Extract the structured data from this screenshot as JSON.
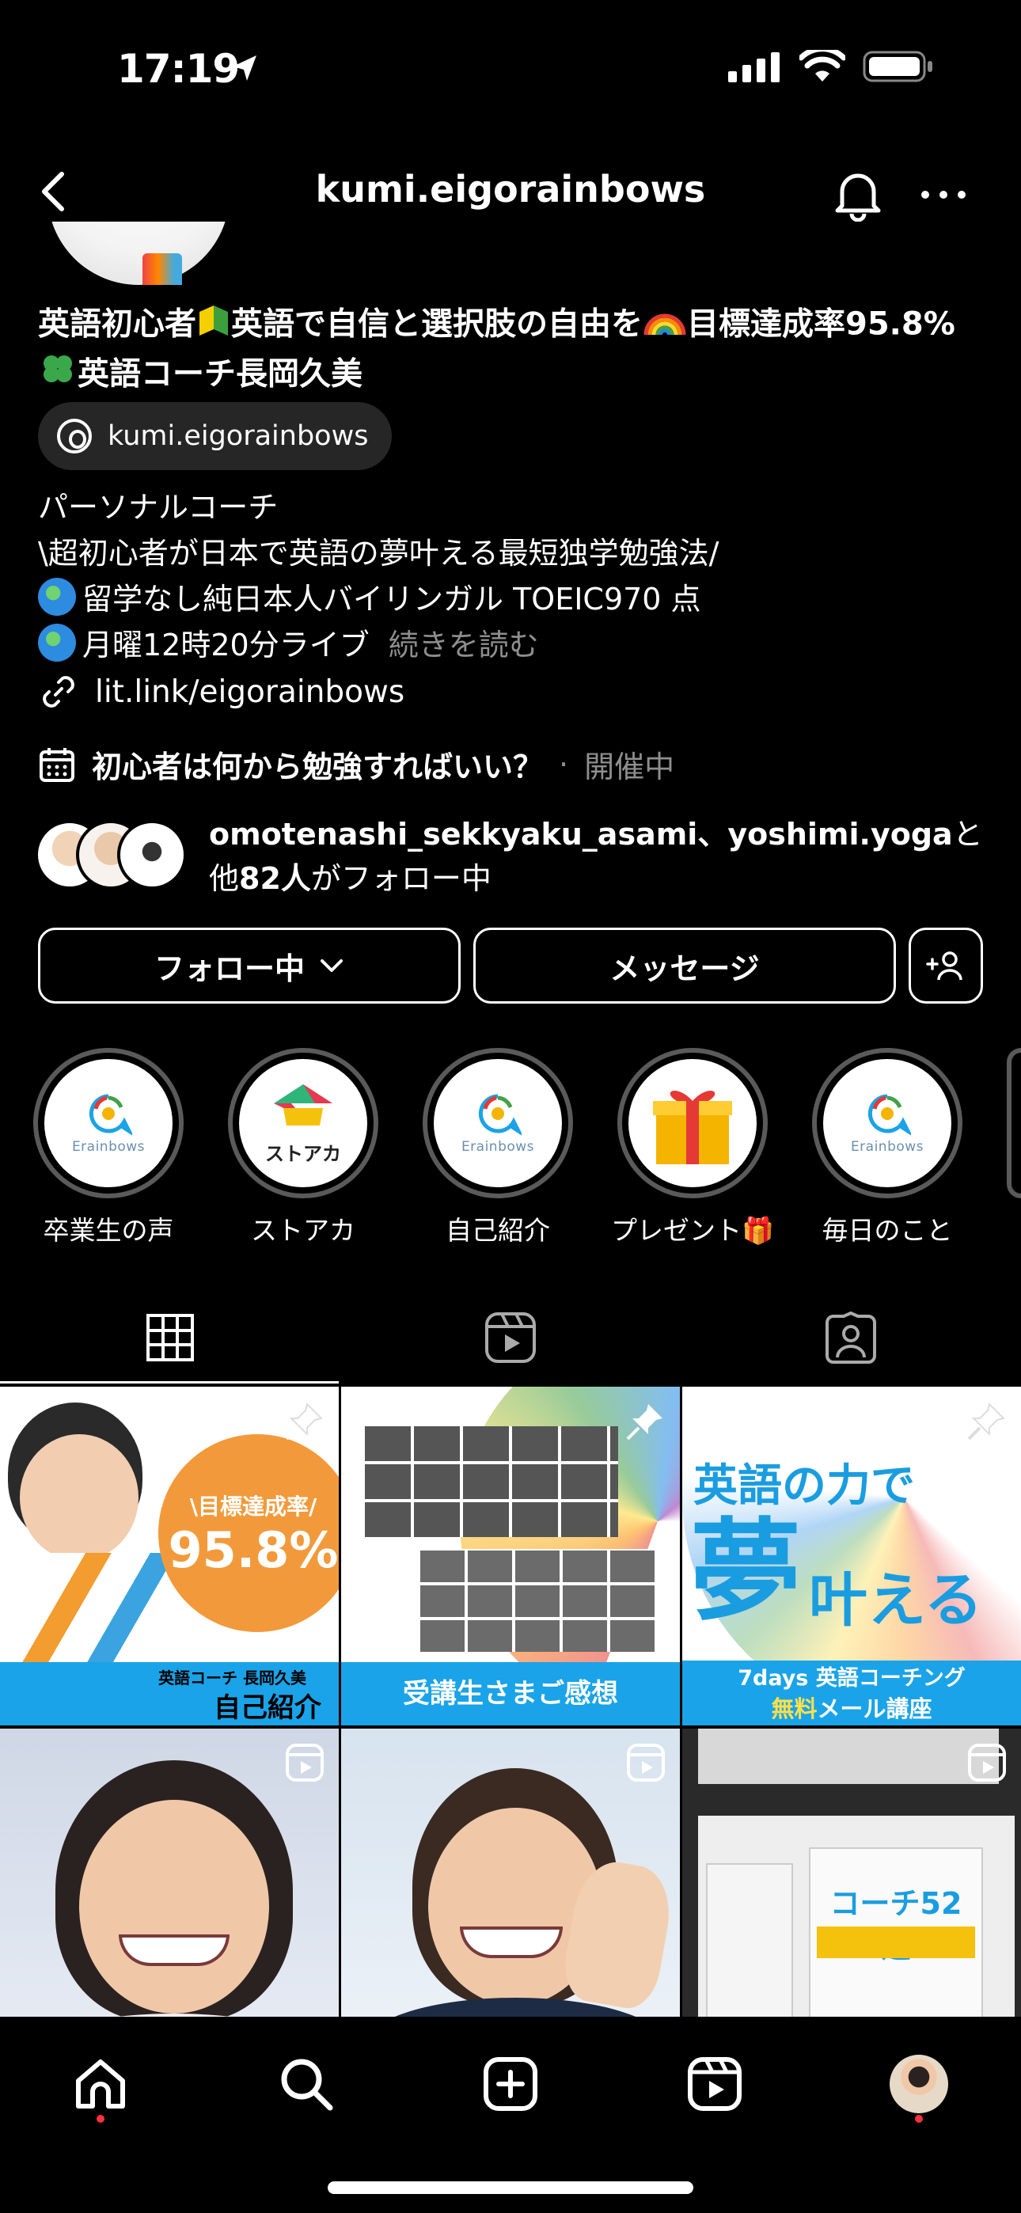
{
  "status": {
    "time": "17:19"
  },
  "header": {
    "username": "kumi.eigorainbows"
  },
  "bio": {
    "name_line1_a": "英語初心者",
    "name_line1_b": "英語で自信と選択肢の自由を",
    "name_line1_c": "目標達成率95.8%",
    "name_line2": "英語コーチ長岡久美",
    "threads_handle": "kumi.eigorainbows",
    "category": "パーソナルコーチ",
    "line1": "\\超初心者が日本で英語の夢叶える最短独学勉強法/",
    "line2": "留学なし純日本人バイリンガル TOEIC970 点",
    "line3": "月曜12時20分ライブ",
    "more": "続きを読む",
    "link": "lit.link/eigorainbows"
  },
  "event": {
    "title": "初心者は何から勉強すればいい？",
    "separator": "·",
    "status": "開催中"
  },
  "followed_by": {
    "names": "omotenashi_sekkyaku_asami、yoshimi.yoga",
    "suffix1": "と",
    "prefix2": "他",
    "count": "82人",
    "suffix2": "がフォロー中"
  },
  "buttons": {
    "following": "フォロー中",
    "message": "メッセージ"
  },
  "highlights": [
    {
      "label": "卒業生の声",
      "logo": "Erainbows"
    },
    {
      "label": "ストアカ",
      "logo": "ストアカ"
    },
    {
      "label": "自己紹介",
      "logo": "Erainbows"
    },
    {
      "label": "プレゼント🎁",
      "logo": ""
    },
    {
      "label": "毎日のこと",
      "logo": "Erainbows"
    }
  ],
  "posts": {
    "p1": {
      "top": "\\目標達成率/",
      "big": "95.8%",
      "sub": "英語コーチ 長岡久美",
      "caption": "自己紹介"
    },
    "p2": {
      "caption": "受講生さまご感想"
    },
    "p3": {
      "line1": "英語の力で",
      "big1": "夢",
      "big2": "叶える",
      "sub": "7days 英語コーチング",
      "sub2a": "無料",
      "sub2b": "メール講座"
    },
    "p6": {
      "book": "コーチ52選"
    }
  },
  "colors": {
    "accent_orange": "#f29a3b",
    "blue": "#1aa3e8",
    "notification": "#ff3040"
  }
}
